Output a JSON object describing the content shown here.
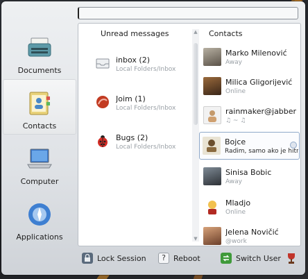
{
  "search": {
    "value": "",
    "placeholder": ""
  },
  "nav": {
    "items": [
      {
        "label": "Documents",
        "icon": "typewriter-icon"
      },
      {
        "label": "Contacts",
        "icon": "address-book-icon"
      },
      {
        "label": "Computer",
        "icon": "laptop-icon"
      },
      {
        "label": "Applications",
        "icon": "applications-icon"
      }
    ],
    "active_index": 1
  },
  "unread": {
    "header": "Unread messages",
    "items": [
      {
        "title": "inbox (2)",
        "sub": "Local Folders/Inbox",
        "icon": "inbox-icon"
      },
      {
        "title": "Joim (1)",
        "sub": "Local Folders/Inbox",
        "icon": "joim-icon"
      },
      {
        "title": "Bugs (2)",
        "sub": "Local Folders/Inbox",
        "icon": "ladybug-icon"
      }
    ]
  },
  "contacts": {
    "header": "Contacts",
    "items": [
      {
        "name": "Marko Milenović",
        "status": "Away"
      },
      {
        "name": "Milica Gligorijević",
        "status": "Online"
      },
      {
        "name": "rainmaker@jabber",
        "status": "♫ ~ ♫"
      },
      {
        "name": "Bojce",
        "status": "Radim, samo ako je hitno"
      },
      {
        "name": "Sinisa Bobic",
        "status": "Away"
      },
      {
        "name": "Mladjo",
        "status": "Online"
      },
      {
        "name": "Jelena Novičić",
        "status": "@work"
      }
    ],
    "selected_index": 3
  },
  "bottom": {
    "lock_label": "Lock Session",
    "reboot_label": "Reboot",
    "switch_label": "Switch User"
  },
  "colors": {
    "accent": "#8fa9c9",
    "muted_text": "#9aa0a6"
  }
}
